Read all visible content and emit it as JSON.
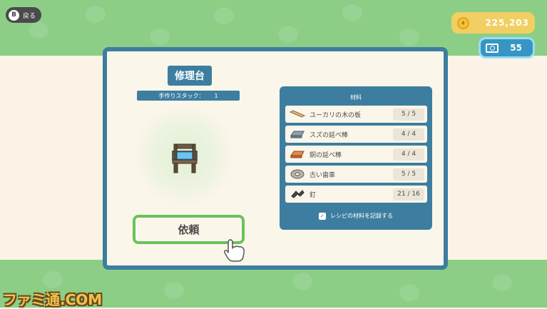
{
  "header": {
    "back_button": {
      "key": "B",
      "label": "戻る"
    },
    "bells": "225,203",
    "miles": "55"
  },
  "recipe": {
    "title": "修理台",
    "stack_label": "手作りスタック：",
    "stack_value": "1",
    "request_button": "依頼"
  },
  "materials": {
    "heading": "材料",
    "items": [
      {
        "name": "ユーカリの木の板",
        "count": "5 / 5",
        "icon": "wood-plank-icon"
      },
      {
        "name": "スズの延べ棒",
        "count": "4 / 4",
        "icon": "tin-ingot-icon"
      },
      {
        "name": "銅の延べ棒",
        "count": "4 / 4",
        "icon": "copper-ingot-icon"
      },
      {
        "name": "古い歯車",
        "count": "5 / 5",
        "icon": "gear-icon"
      },
      {
        "name": "釘",
        "count": "21 / 16",
        "icon": "nails-icon"
      }
    ],
    "record_label": "レシピの材料を記録する",
    "record_checked": true
  },
  "watermark": "ファミ通.COM",
  "colors": {
    "panel_border": "#3d7ea0",
    "grass": "#8cce86",
    "bells_bg": "#f2cf62",
    "miles_bg": "#3795c3",
    "button_border": "#6cc25a"
  }
}
